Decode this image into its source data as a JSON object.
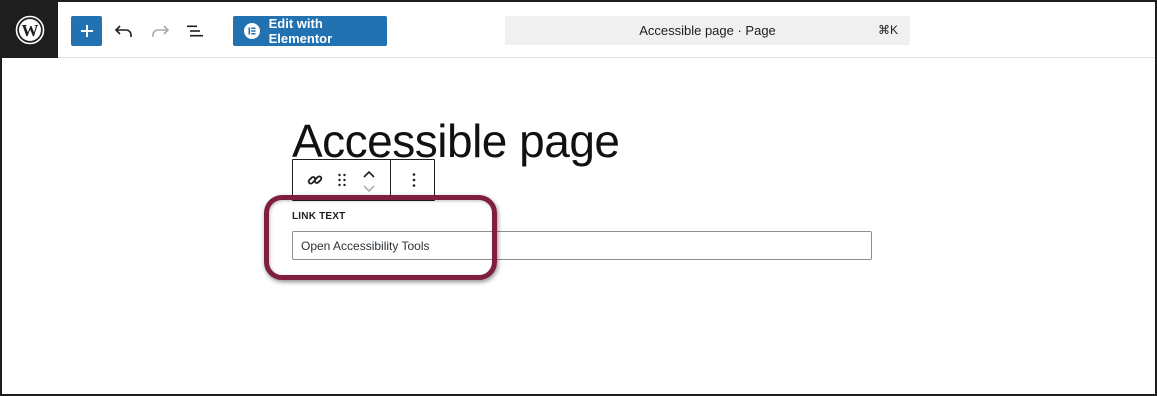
{
  "topbar": {
    "wordpress_logo": "wordpress-logo-icon",
    "add_block_icon": "plus-icon",
    "undo_icon": "undo-icon",
    "redo_icon": "redo-icon",
    "document_overview_icon": "list-view-icon",
    "elementor_button_label": "Edit with Elementor",
    "elementor_icon": "elementor-icon",
    "command_title": "Accessible page · Page",
    "command_shortcut": "⌘K"
  },
  "editor": {
    "page_title": "Accessible page",
    "block_toolbar": {
      "link_icon": "link-icon",
      "drag_icon": "drag-handle-icon",
      "move_up_icon": "chevron-up-icon",
      "move_down_icon": "chevron-down-icon",
      "options_icon": "more-vertical-icon"
    },
    "link_text_label": "LINK TEXT",
    "link_text_value": "Open Accessibility Tools"
  },
  "colors": {
    "brand_blue": "#2271b1",
    "highlight": "#7d1f3d",
    "wp_dark": "#1e1e1e"
  }
}
